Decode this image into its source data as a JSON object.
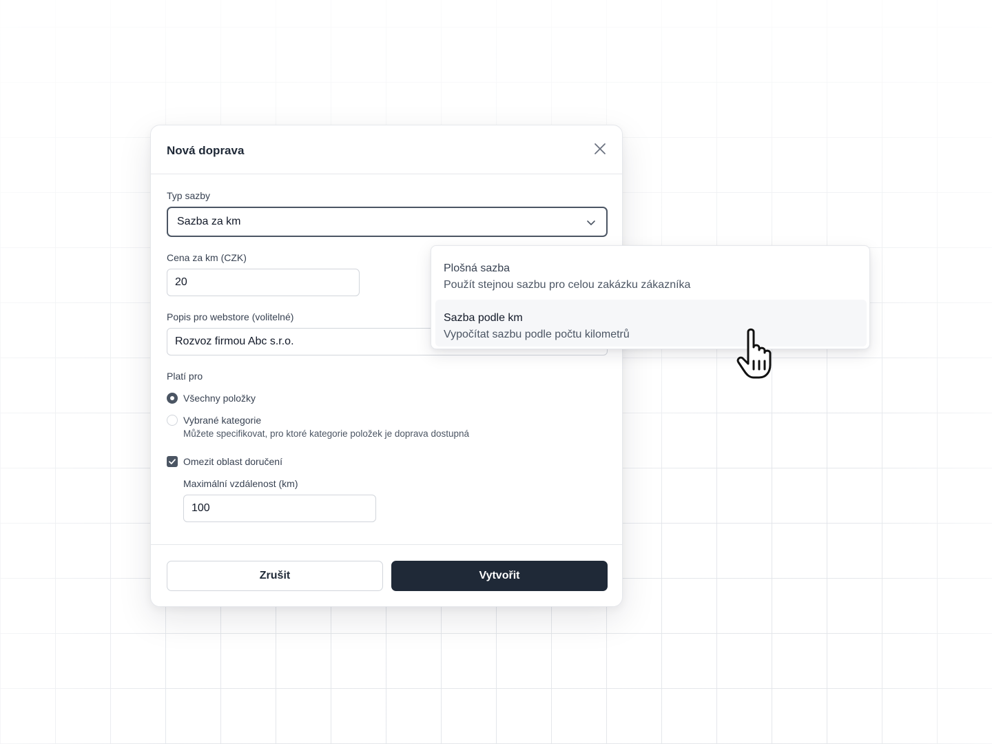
{
  "modal": {
    "title": "Nová doprava",
    "close_icon": "close-icon",
    "rate_type": {
      "label": "Typ sazby",
      "value": "Sazba za km",
      "icon": "chevron-down-icon"
    },
    "price_per_km": {
      "label": "Cena za km (CZK)",
      "value": "20"
    },
    "description": {
      "label": "Popis pro webstore (volitelné)",
      "value": "Rozvoz firmou Abc s.r.o."
    },
    "applies_to": {
      "label": "Platí pro",
      "options": [
        {
          "label": "Všechny položky",
          "selected": true
        },
        {
          "label": "Vybrané kategorie",
          "selected": false,
          "hint": "Můžete specifikovat, pro ktoré kategorie položek je doprava dostupná"
        }
      ]
    },
    "limit_area": {
      "label": "Omezit oblast doručení",
      "checked": true,
      "max_distance": {
        "label": "Maximální vzdálenost (km)",
        "value": "100"
      }
    },
    "buttons": {
      "cancel": "Zrušit",
      "create": "Vytvořit"
    }
  },
  "dropdown": {
    "items": [
      {
        "title": "Plošná sazba",
        "description": "Použít stejnou sazbu pro celou zakázku zákazníka",
        "highlighted": false
      },
      {
        "title": "Sazba podle km",
        "description": "Vypočítat sazbu podle počtu kilometrů",
        "highlighted": true
      }
    ]
  },
  "cursor_icon": "hand-pointer-icon",
  "colors": {
    "primary": "#1f2937",
    "control": "#4b5563",
    "border": "#d1d5db",
    "highlight": "#f6f7f9"
  }
}
